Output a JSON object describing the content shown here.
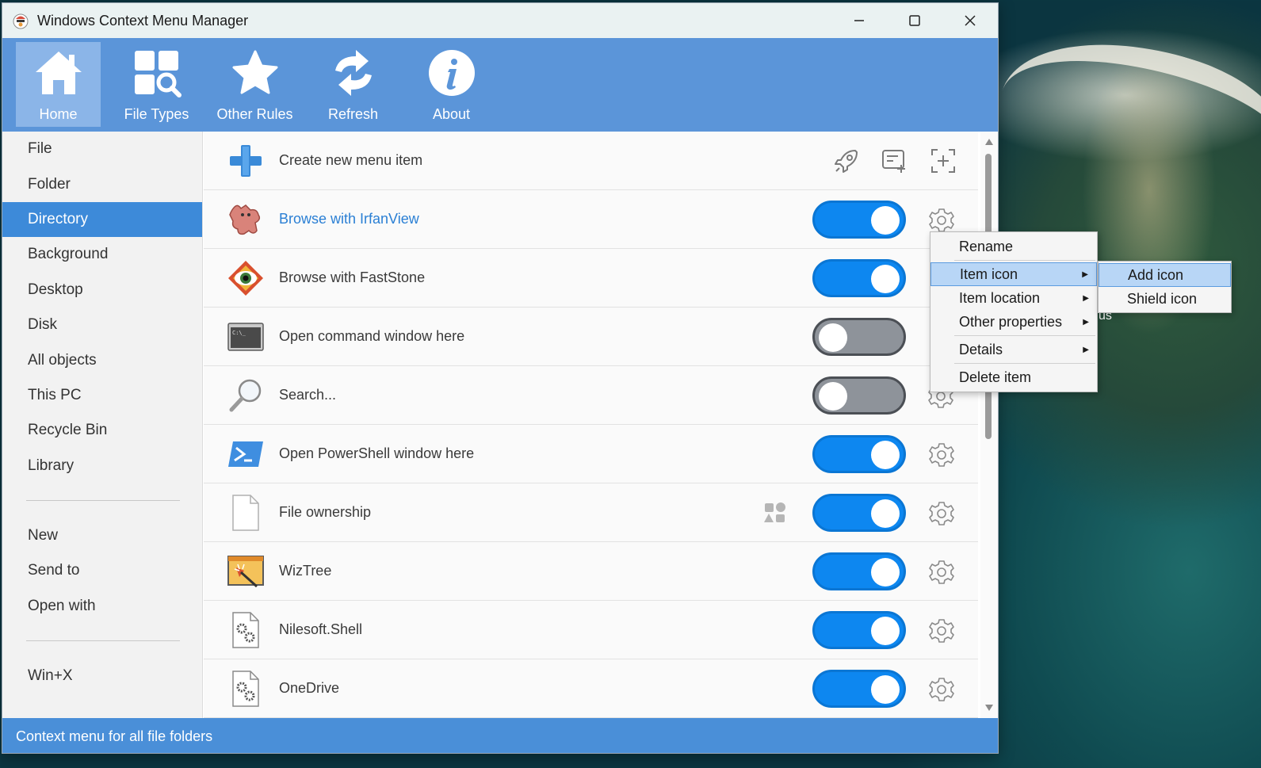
{
  "window": {
    "title": "Windows Context Menu Manager",
    "controls": [
      "minimize-icon",
      "maximize-icon",
      "close-icon"
    ]
  },
  "ribbon": {
    "buttons": [
      {
        "label": "Home",
        "icon": "home-icon",
        "active": true
      },
      {
        "label": "File Types",
        "icon": "file-types-icon",
        "active": false
      },
      {
        "label": "Other Rules",
        "icon": "star-icon",
        "active": false
      },
      {
        "label": "Refresh",
        "icon": "refresh-icon",
        "active": false
      },
      {
        "label": "About",
        "icon": "info-icon",
        "active": false
      }
    ]
  },
  "sidebar": {
    "group1": [
      "File",
      "Folder",
      "Directory",
      "Background",
      "Desktop",
      "Disk",
      "All objects",
      "This PC",
      "Recycle Bin",
      "Library"
    ],
    "group2": [
      "New",
      "Send to",
      "Open with"
    ],
    "group3": [
      "Win+X"
    ],
    "selected": "Directory"
  },
  "main": {
    "create_label": "Create new menu item",
    "tools": [
      "rocket-icon",
      "add-note-icon",
      "add-capture-icon"
    ],
    "items": [
      {
        "label": "Browse with IrfanView",
        "on": true,
        "icon": "irfanview-icon",
        "highlighted": true
      },
      {
        "label": "Browse with FastStone",
        "on": true,
        "icon": "faststone-icon",
        "highlighted": false
      },
      {
        "label": "Open command window here",
        "on": false,
        "icon": "cmd-icon",
        "highlighted": false
      },
      {
        "label": "Search...",
        "on": false,
        "icon": "magnifier-icon",
        "highlighted": false
      },
      {
        "label": "Open PowerShell window here",
        "on": true,
        "icon": "powershell-icon",
        "highlighted": false
      },
      {
        "label": "File ownership",
        "on": true,
        "icon": "blank-file-icon",
        "highlighted": false
      },
      {
        "label": "WizTree",
        "on": true,
        "icon": "wiztree-icon",
        "highlighted": false
      },
      {
        "label": "Nilesoft.Shell",
        "on": true,
        "icon": "settings-file-icon",
        "highlighted": false
      },
      {
        "label": "OneDrive",
        "on": true,
        "icon": "settings-file-icon",
        "highlighted": false
      }
    ]
  },
  "context_menu": {
    "items": [
      "Rename",
      "Item icon",
      "Item location",
      "Other properties",
      "Details",
      "Delete item"
    ],
    "highlighted": "Item icon"
  },
  "submenu": {
    "items": [
      "Add icon",
      "Shield icon"
    ],
    "highlighted": "Add icon"
  },
  "desktop_fragment": "us",
  "status": {
    "text": "Context menu for all file folders"
  },
  "colors": {
    "ribbon": "#5b95d9",
    "selected": "#3d8ad9",
    "toggle_on": "#0d87f0",
    "toggle_off": "#8e939a",
    "status": "#4a8fd8"
  }
}
